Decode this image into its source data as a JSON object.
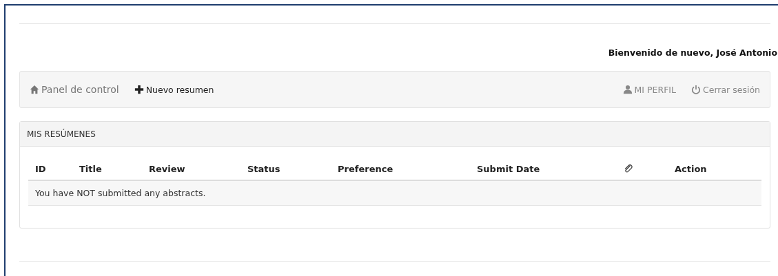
{
  "welcome": "Bienvenido de nuevo, José Antonio",
  "navbar": {
    "left": [
      {
        "kind": "home",
        "label": "Panel de control"
      },
      {
        "kind": "plus",
        "label": "Nuevo resumen"
      }
    ],
    "right": [
      {
        "kind": "user",
        "label": "MI PERFIL"
      },
      {
        "kind": "power",
        "label": "Cerrar sesión"
      }
    ]
  },
  "panel": {
    "title": "MIS RESÚMENES",
    "table": {
      "columns": [
        {
          "kind": "text",
          "label": "ID"
        },
        {
          "kind": "text",
          "label": "Title"
        },
        {
          "kind": "text",
          "label": "Review"
        },
        {
          "kind": "text",
          "label": "Status"
        },
        {
          "kind": "text",
          "label": "Preference"
        },
        {
          "kind": "text",
          "label": "Submit Date"
        },
        {
          "kind": "attachment"
        },
        {
          "kind": "text",
          "label": "Action"
        }
      ],
      "empty_message": "You have NOT submitted any abstracts."
    }
  }
}
